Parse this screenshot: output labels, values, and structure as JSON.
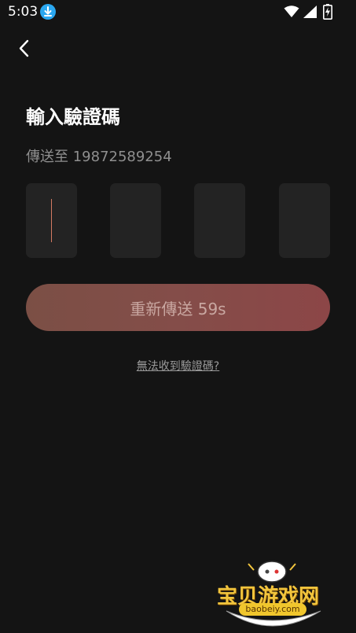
{
  "status_bar": {
    "time": "5:03",
    "icons": [
      "download-icon",
      "wifi-icon",
      "signal-icon",
      "battery-charging-icon"
    ]
  },
  "header": {
    "back_icon": "chevron-left-icon"
  },
  "title": "輸入驗證碼",
  "send_to": "傳送至 19872589254",
  "code_boxes": [
    {
      "value": "",
      "focused": true
    },
    {
      "value": "",
      "focused": false
    },
    {
      "value": "",
      "focused": false
    },
    {
      "value": "",
      "focused": false
    }
  ],
  "resend_button": {
    "label": "重新傳送 59s",
    "enabled": false
  },
  "no_receive_link": "無法收到驗證碼?",
  "watermark": {
    "text": "宝贝游戏网",
    "url": "baobeiy.com"
  },
  "colors": {
    "background": "#141414",
    "box": "#232323",
    "caret": "#d47a62",
    "button_start": "#7b4f45",
    "button_end": "#8c4647",
    "secondary_text": "#8f8f8f"
  }
}
